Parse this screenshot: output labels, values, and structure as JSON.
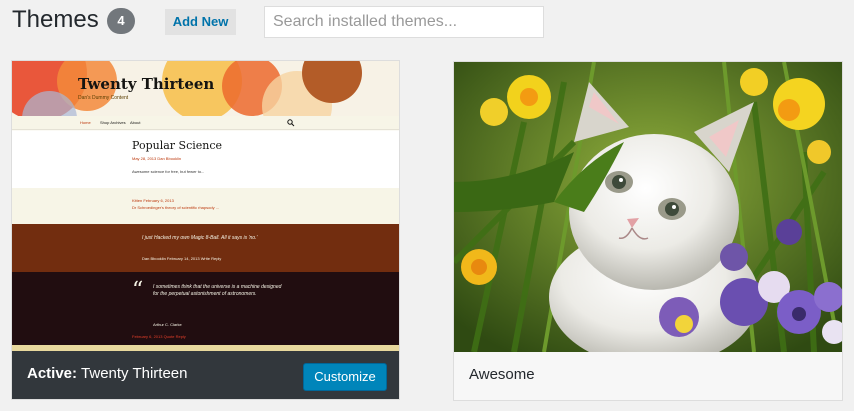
{
  "header": {
    "title": "Themes",
    "count": "4",
    "add_new_label": "Add New",
    "search_placeholder": "Search installed themes..."
  },
  "themes": [
    {
      "name": "Twenty Thirteen",
      "active": true,
      "active_prefix": "Active:",
      "customize_label": "Customize",
      "preview": {
        "site_title": "Twenty Thirteen",
        "tagline": "Dan's Dummy Content",
        "nav": [
          "Home",
          "Shop Archives",
          "About"
        ],
        "post_title": "Popular Science",
        "post_meta": "May 28, 2013   Dan Bbooklin",
        "post_excerpt": "Awesome science for free, but fewer to...",
        "aside_meta": "Kitten    February 6, 2013",
        "aside_text": "Dr Schroedinger's theory of scientific rhapsody ...",
        "status_text": "I just Hacked my own Magic 8-Ball. All it says is 'no.'",
        "status_meta": "Dan Bbooklin   February 14, 2013   Write Reply",
        "quote_mark": "“",
        "quote_text": "I sometimes think that the universe is a machine designed for the perpetual astonishment of astronomers.",
        "quote_cite": "Arthur C. Clarke",
        "quote_meta": "February 6, 2013   Quote   Reply"
      }
    },
    {
      "name": "Awesome",
      "active": false
    }
  ],
  "colors": {
    "accent": "#0085ba",
    "active_bar": "#32373c",
    "count_badge": "#72777c"
  }
}
